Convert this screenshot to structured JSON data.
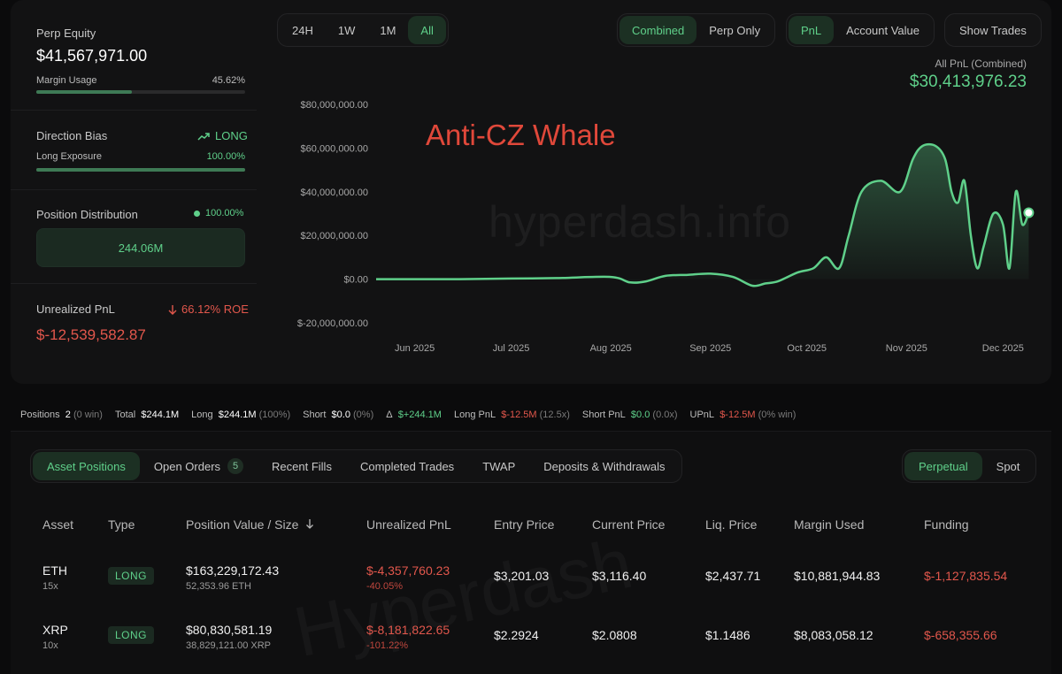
{
  "stats": {
    "perp_equity_label": "Perp Equity",
    "perp_equity": "$41,567,971.00",
    "margin_usage_label": "Margin Usage",
    "margin_usage": "45.62%",
    "margin_usage_fraction": 0.4562,
    "direction_bias_label": "Direction Bias",
    "direction": "LONG",
    "long_exposure_label": "Long Exposure",
    "long_exposure": "100.00%",
    "long_exposure_fraction": 1.0,
    "position_distribution_label": "Position Distribution",
    "position_distribution": "100.00%",
    "distribution_value": "244.06M",
    "unrealized_pnl_label": "Unrealized PnL",
    "roe": "66.12% ROE",
    "unrealized_pnl": "$-12,539,582.87"
  },
  "range_tabs": [
    "24H",
    "1W",
    "1M",
    "All"
  ],
  "range_active": "All",
  "mode_tabs": [
    "Combined",
    "Perp Only"
  ],
  "mode_active": "Combined",
  "metric_tabs": [
    "PnL",
    "Account Value"
  ],
  "metric_active": "PnL",
  "show_trades": "Show Trades",
  "pnl_header": {
    "label": "All PnL (Combined)",
    "value": "$30,413,976.23"
  },
  "annotation": "Anti-CZ Whale",
  "watermark": "hyperdash.info",
  "watermark2": "Hyperdash",
  "chart_data": {
    "type": "area",
    "y_ticks": [
      "$80,000,000.00",
      "$60,000,000.00",
      "$40,000,000.00",
      "$20,000,000.00",
      "$0.00",
      "$-20,000,000.00"
    ],
    "x_ticks": [
      "Jun 2025",
      "Jul 2025",
      "Aug 2025",
      "Sep 2025",
      "Oct 2025",
      "Nov 2025",
      "Dec 2025"
    ],
    "ylim": [
      -20000000,
      80000000
    ],
    "xlim": [
      "2025-05-20",
      "2025-12-10"
    ],
    "grid": false,
    "color": "#5fd08a",
    "series": [
      {
        "x": [
          "2025-05-20",
          "2025-06-01",
          "2025-06-15",
          "2025-07-01",
          "2025-07-15",
          "2025-08-01",
          "2025-08-07",
          "2025-08-12",
          "2025-08-18",
          "2025-08-25",
          "2025-09-01",
          "2025-09-08",
          "2025-09-14",
          "2025-09-18",
          "2025-09-22",
          "2025-09-28",
          "2025-10-03",
          "2025-10-07",
          "2025-10-11",
          "2025-10-14",
          "2025-10-18",
          "2025-10-24",
          "2025-10-30",
          "2025-11-03",
          "2025-11-06",
          "2025-11-10",
          "2025-11-13",
          "2025-11-15",
          "2025-11-17",
          "2025-11-19",
          "2025-11-21",
          "2025-11-23",
          "2025-11-25",
          "2025-11-28",
          "2025-12-01",
          "2025-12-03",
          "2025-12-05",
          "2025-12-07",
          "2025-12-09"
        ],
        "values": [
          0,
          0,
          0,
          300000,
          500000,
          1000000,
          -1500000,
          -1000000,
          1500000,
          2000000,
          2500000,
          1000000,
          -3000000,
          -2000000,
          -1000000,
          3000000,
          5000000,
          10000000,
          5000000,
          20000000,
          40000000,
          45000000,
          40000000,
          55000000,
          61000000,
          61000000,
          55000000,
          40000000,
          35000000,
          45000000,
          20000000,
          5000000,
          15000000,
          30000000,
          25000000,
          5000000,
          40000000,
          25000000,
          30400000
        ]
      }
    ]
  },
  "summary": {
    "positions_label": "Positions",
    "positions": "2",
    "positions_win": "(0 win)",
    "total_label": "Total",
    "total": "$244.1M",
    "long_label": "Long",
    "long": "$244.1M",
    "long_pct": "(100%)",
    "short_label": "Short",
    "short": "$0.0",
    "short_pct": "(0%)",
    "delta_label": "Δ",
    "delta": "$+244.1M",
    "long_pnl_label": "Long PnL",
    "long_pnl": "$-12.5M",
    "long_pnl_x": "(12.5x)",
    "short_pnl_label": "Short PnL",
    "short_pnl": "$0.0",
    "short_pnl_x": "(0.0x)",
    "upnl_label": "UPnL",
    "upnl": "$-12.5M",
    "upnl_win": "(0% win)"
  },
  "position_tabs": [
    "Asset Positions",
    "Open Orders",
    "Recent Fills",
    "Completed Trades",
    "TWAP",
    "Deposits & Withdrawals"
  ],
  "open_orders_count": "5",
  "market_tabs": [
    "Perpetual",
    "Spot"
  ],
  "table": {
    "headers": [
      "Asset",
      "Type",
      "Position Value / Size",
      "Unrealized PnL",
      "Entry Price",
      "Current Price",
      "Liq. Price",
      "Margin Used",
      "Funding"
    ],
    "rows": [
      {
        "asset": "ETH",
        "leverage": "15x",
        "type": "LONG",
        "value": "$163,229,172.43",
        "size": "52,353.96 ETH",
        "upnl": "$-4,357,760.23",
        "upnl_pct": "-40.05%",
        "entry": "$3,201.03",
        "current": "$3,116.40",
        "liq": "$2,437.71",
        "margin": "$10,881,944.83",
        "funding": "$-1,127,835.54"
      },
      {
        "asset": "XRP",
        "leverage": "10x",
        "type": "LONG",
        "value": "$80,830,581.19",
        "size": "38,829,121.00 XRP",
        "upnl": "$-8,181,822.65",
        "upnl_pct": "-101.22%",
        "entry": "$2.2924",
        "current": "$2.0808",
        "liq": "$1.1486",
        "margin": "$8,083,058.12",
        "funding": "$-658,355.66"
      }
    ]
  }
}
